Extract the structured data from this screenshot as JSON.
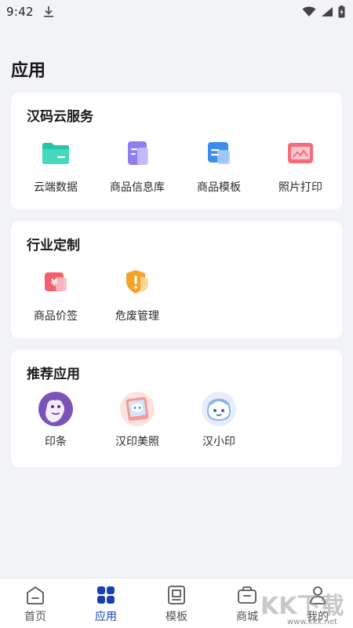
{
  "status": {
    "time": "9:42"
  },
  "page": {
    "title": "应用"
  },
  "sections": [
    {
      "title": "汉码云服务",
      "items": [
        {
          "label": "云端数据",
          "icon": "cloud-folder-icon"
        },
        {
          "label": "商品信息库",
          "icon": "product-database-icon"
        },
        {
          "label": "商品模板",
          "icon": "product-template-icon"
        },
        {
          "label": "照片打印",
          "icon": "photo-print-icon"
        }
      ]
    },
    {
      "title": "行业定制",
      "items": [
        {
          "label": "商品价签",
          "icon": "price-tag-icon"
        },
        {
          "label": "危废管理",
          "icon": "hazard-shield-icon"
        }
      ]
    },
    {
      "title": "推荐应用",
      "items": [
        {
          "label": "印条",
          "icon": "yintiao-app-icon"
        },
        {
          "label": "汉印美照",
          "icon": "hanyin-meizhao-app-icon"
        },
        {
          "label": "汉小印",
          "icon": "hanxiaoyin-app-icon"
        }
      ]
    }
  ],
  "nav": {
    "items": [
      {
        "label": "首页",
        "icon": "home-icon"
      },
      {
        "label": "应用",
        "icon": "apps-grid-icon",
        "active": true
      },
      {
        "label": "模板",
        "icon": "template-icon"
      },
      {
        "label": "商城",
        "icon": "store-icon"
      },
      {
        "label": "我的",
        "icon": "profile-icon"
      }
    ]
  },
  "watermark": {
    "brand": "KK下载",
    "url": "www.kkx.net"
  },
  "colors": {
    "accent": "#1a3fb0",
    "background": "#f2f3f7",
    "card": "#ffffff"
  }
}
